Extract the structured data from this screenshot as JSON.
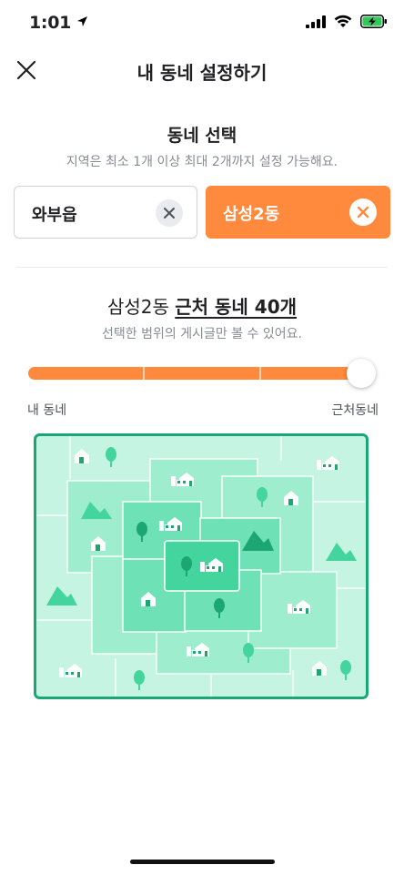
{
  "status_bar": {
    "time": "1:01"
  },
  "header": {
    "title": "내 동네 설정하기"
  },
  "select_section": {
    "title": "동네 선택",
    "subtitle": "지역은 최소 1개 이상 최대 2개까지 설정 가능해요."
  },
  "chips": [
    {
      "label": "와부읍",
      "selected": false
    },
    {
      "label": "삼성2동",
      "selected": true
    }
  ],
  "range_section": {
    "prefix": "삼성2동",
    "highlight": "근처 동네 40개",
    "subtitle": "선택한 범위의 게시글만 볼 수 있어요.",
    "slider_min_label": "내 동네",
    "slider_max_label": "근처동네",
    "slider_steps": 4,
    "slider_value_step": 4
  },
  "colors": {
    "accent": "#ff8a3d",
    "map_border": "#1ca673",
    "map_light": "#c5f5e2",
    "map_mid": "#9eedce",
    "map_strong": "#6fe1b6",
    "map_center": "#44d49d"
  }
}
